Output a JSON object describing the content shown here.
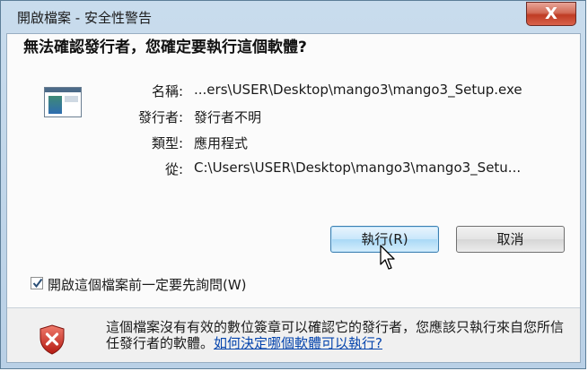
{
  "window": {
    "title": "開啟檔案 - 安全性警告",
    "close_label": "X"
  },
  "dialog": {
    "heading": "無法確認發行者，您確定要執行這個軟體?",
    "fields": [
      {
        "label": "名稱:",
        "value": "...ers\\USER\\Desktop\\mango3\\mango3_Setup.exe"
      },
      {
        "label": "發行者:",
        "value": "發行者不明"
      },
      {
        "label": "類型:",
        "value": "應用程式"
      },
      {
        "label": "從:",
        "value": "C:\\Users\\USER\\Desktop\\mango3\\mango3_Setu..."
      }
    ],
    "run_button": "執行(R)",
    "cancel_button": "取消",
    "checkbox_label": "開啟這個檔案前一定要先詢問(W)",
    "checkbox_checked": true,
    "warning_text": "這個檔案沒有有效的數位簽章可以確認它的發行者，您應該只執行來自您所信任發行者的軟體。",
    "warning_link": "如何決定哪個軟體可以執行?"
  },
  "colors": {
    "title_bar": "#c9dced",
    "close_button": "#c94a35",
    "link": "#0645ad",
    "shield": "#c4251c"
  },
  "icons": {
    "file": "application-file-icon",
    "shield": "security-shield-x-icon",
    "cursor": "mouse-pointer-icon"
  }
}
